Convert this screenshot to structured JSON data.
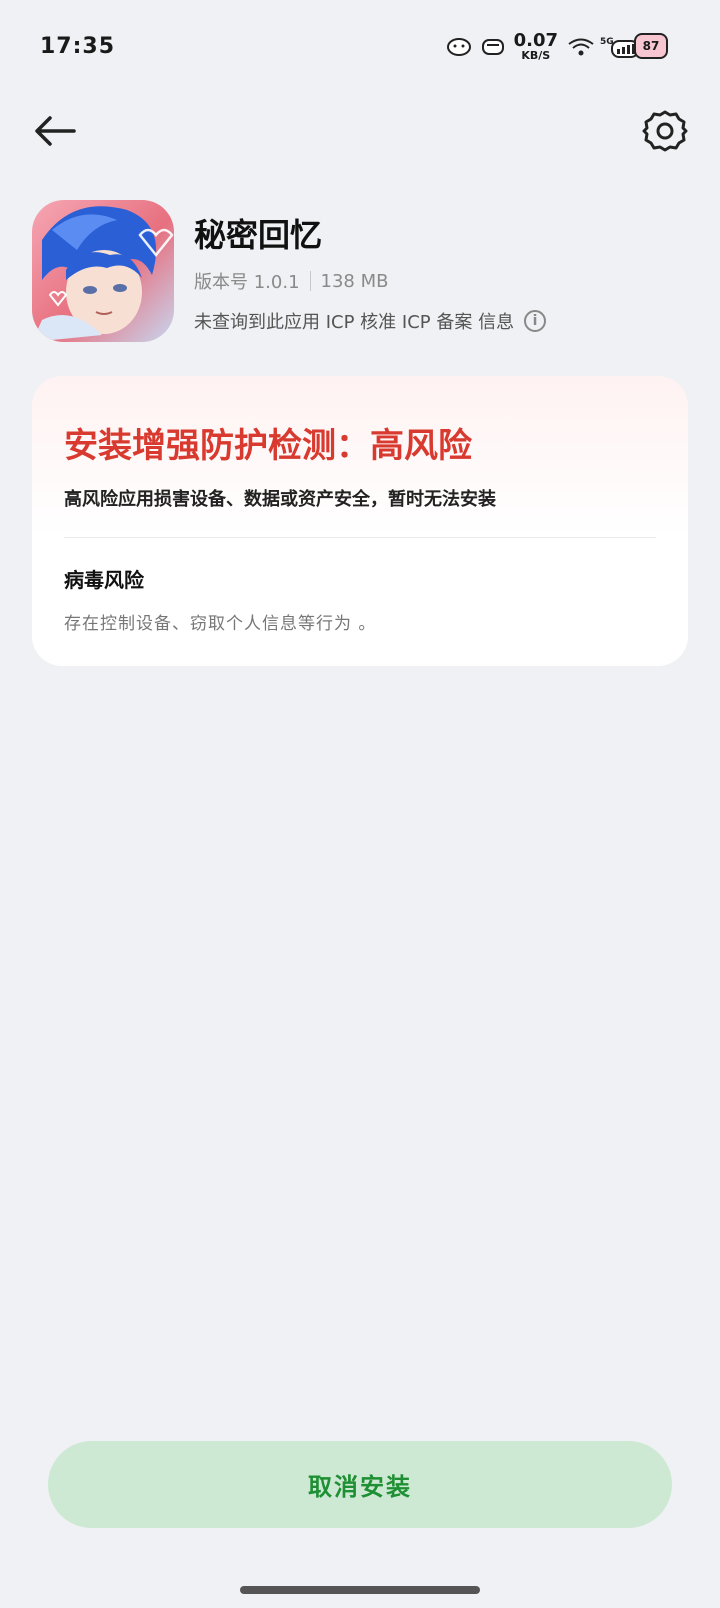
{
  "status_bar": {
    "time": "17:35",
    "net_speed_value": "0.07",
    "net_speed_unit": "KB/S",
    "signal_label": "5G",
    "battery": "87"
  },
  "app": {
    "name": "秘密回忆",
    "version_text": "版本号 1.0.1",
    "size_text": "138 MB",
    "icp_text": "未查询到此应用 ICP 核准 ICP 备案 信息"
  },
  "risk_card": {
    "title": "安装增强防护检测：高风险",
    "description": "高风险应用损害设备、数据或资产安全，暂时无法安装",
    "risk_type_title": "病毒风险",
    "risk_type_desc": "存在控制设备、窃取个人信息等行为 。"
  },
  "actions": {
    "cancel_label": "取消安装"
  },
  "colors": {
    "danger": "#d93a2f",
    "cancel_bg": "#cde9d3",
    "cancel_text": "#1f8f34"
  }
}
